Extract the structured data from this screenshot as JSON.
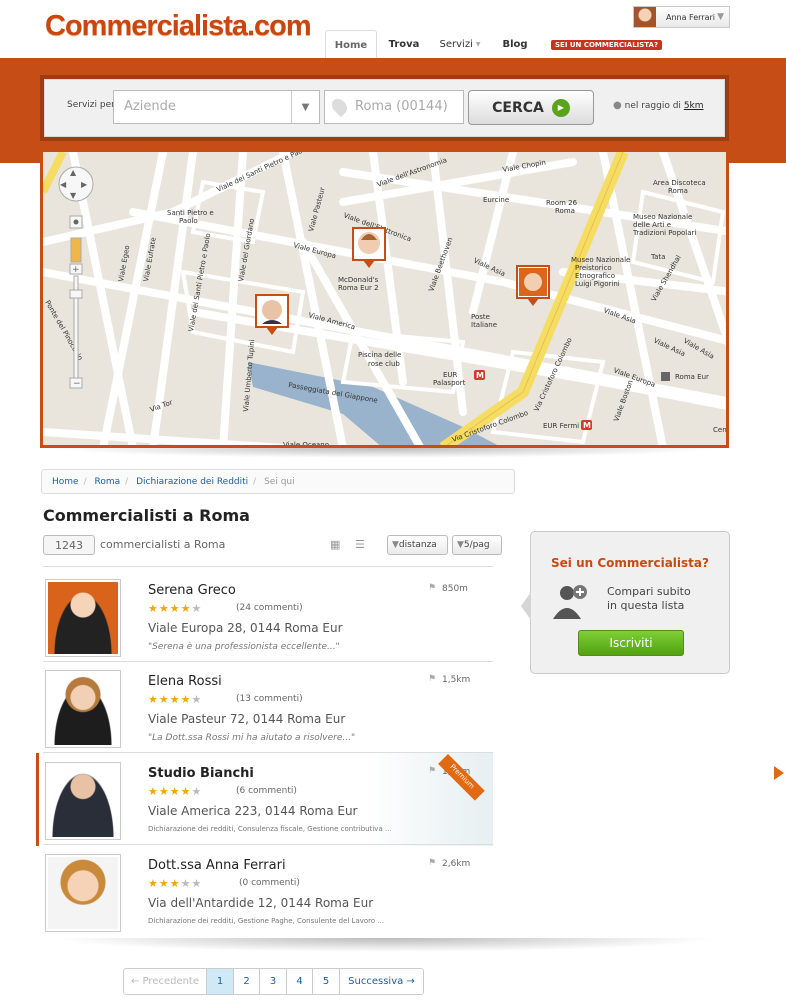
{
  "header": {
    "logo": "Commercialista.com",
    "user_name": "Anna Ferrari",
    "nav": {
      "home": "Home",
      "trova": "Trova",
      "servizi": "Servizi",
      "blog": "Blog"
    },
    "badge": "SEI UN COMMERCIALISTA?"
  },
  "search": {
    "servizi_label": "Servizi per",
    "servizi_value": "Aziende",
    "location_value": "Roma (00144)",
    "button": "CERCA",
    "radius_prefix": "nel raggio di",
    "radius_value": "5km"
  },
  "map": {
    "labels": [
      "Viale dei Santi Pietro e Paolo",
      "Viale dell'Astronomia",
      "Viale Chopin",
      "Viale dell'Elettronica",
      "Viale Umberto Tupini",
      "Viale Europa",
      "Viale Beethoven",
      "Viale Asia",
      "Viale America",
      "Viale Egeo",
      "Viale Eufrate",
      "Viale del Giordano",
      "Via Cristoforo Colombo",
      "Viale Boston",
      "Viale Shendhal",
      "Piscina delle rose club",
      "EUR Palasport",
      "EUR Fermi",
      "Roma Eur",
      "Poste Italiane",
      "McDonald's Roma Eur 2",
      "Museo Nazionale Preistorico Etnografico Luigi Pigorini",
      "Museo Nazionale delle Arti e Tradizioni Popolari",
      "Area Discoteca Roma",
      "Room 26 Roma",
      "Eurcine",
      "Santi Pietro e Paolo",
      "Passeggiata del Giappone",
      "Via Tor",
      "Tata",
      "Viale Oceano",
      "Ponte del Pinocchio",
      "Viale Egeo"
    ]
  },
  "breadcrumb": {
    "items": [
      "Home",
      "Roma",
      "Dichiarazione dei Redditi"
    ],
    "current": "Sei qui"
  },
  "list": {
    "title": "Commercialisti a Roma",
    "count": "1243",
    "count_label": "commercialisti a Roma",
    "sort_distance": "distanza",
    "per_page": "5/pag",
    "items": [
      {
        "name": "Serena Greco",
        "rating": 4,
        "comments": "(24 commenti)",
        "address": "Viale Europa 28, 0144 Roma Eur",
        "note": "\"Serena è una professionista eccellente...\"",
        "distance": "850m"
      },
      {
        "name": "Elena Rossi",
        "rating": 4,
        "comments": "(13 commenti)",
        "address": "Viale Pasteur 72, 0144 Roma Eur",
        "note": "\"La Dott.ssa Rossi mi ha aiutato a risolvere...\"",
        "distance": "1,5km"
      },
      {
        "name": "Studio Bianchi",
        "rating": 4,
        "comments": "(6 commenti)",
        "address": "Viale America 223, 0144 Roma Eur",
        "note": "Dichiarazione dei redditi, Consulenza fiscale, Gestione contributiva ...",
        "distance": "1,8km",
        "premium": "Premium"
      },
      {
        "name": "Dott.ssa Anna Ferrari",
        "rating": 3,
        "comments": "(0 commenti)",
        "address": "Via dell'Antardide 12, 0144 Roma Eur",
        "note": "Dichiarazione dei redditi, Gestione Paghe, Consulente del Lavoro ...",
        "distance": "2,6km"
      }
    ]
  },
  "side": {
    "title": "Sei un Commercialista?",
    "text1": "Compari subito",
    "text2": "in questa lista",
    "button": "Iscriviti"
  },
  "pager": {
    "prev": "← Precedente",
    "pages": [
      "1",
      "2",
      "3",
      "4",
      "5"
    ],
    "next": "Successiva →"
  },
  "colors": {
    "brand": "#c74d16",
    "link": "#1c5d9b",
    "green": "#5ba31a"
  }
}
